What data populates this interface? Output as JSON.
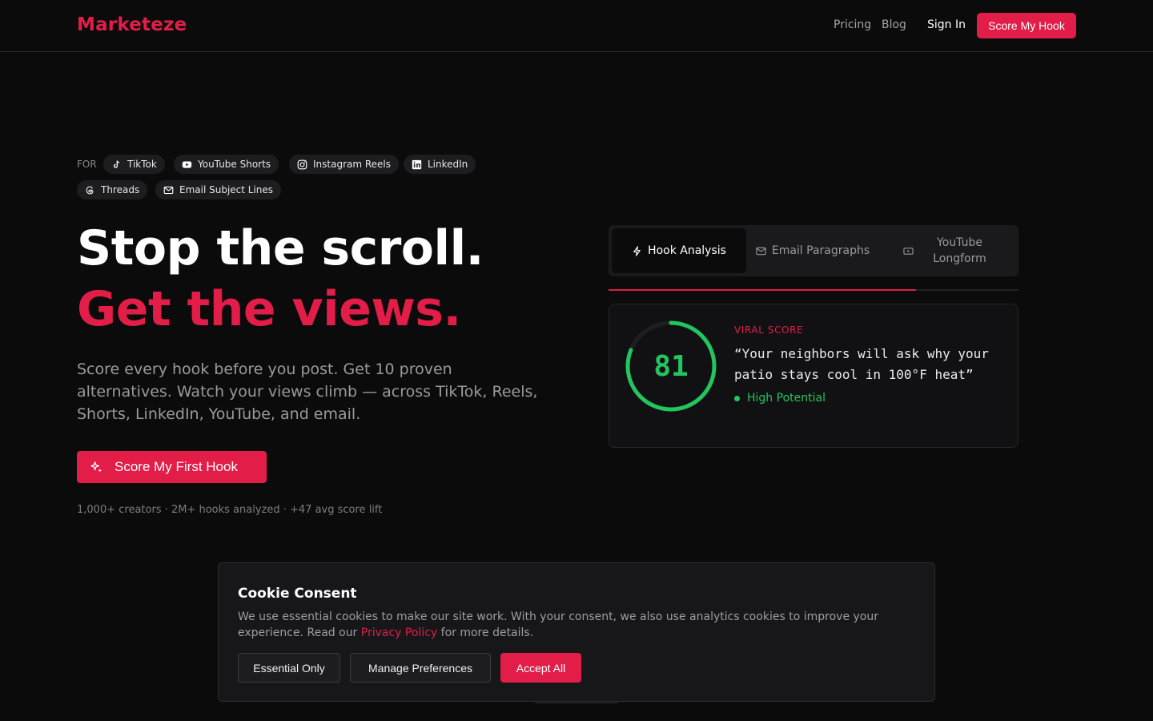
{
  "header": {
    "logo": "Marketeze",
    "nav": [
      "Pricing",
      "Blog"
    ],
    "sign_in": "Sign In",
    "cta": "Score My Hook"
  },
  "platforms": {
    "label": "FOR",
    "items": [
      {
        "label": "TikTok",
        "icon": "tiktok-icon"
      },
      {
        "label": "YouTube Shorts",
        "icon": "youtube-icon"
      },
      {
        "label": "Instagram Reels",
        "icon": "instagram-icon"
      },
      {
        "label": "LinkedIn",
        "icon": "linkedin-icon"
      },
      {
        "label": "Threads",
        "icon": "threads-icon"
      },
      {
        "label": "Email Subject Lines",
        "icon": "mail-icon"
      }
    ]
  },
  "hero": {
    "title_main": "Stop the scroll.",
    "title_accent": "Get the views.",
    "subtitle": "Score every hook before you post. Get 10 proven alternatives. Watch your views climb — across TikTok, Reels, Shorts, LinkedIn, YouTube, and email.",
    "cta": "Score My First Hook",
    "stats": "1,000+ creators · 2M+ hooks analyzed · +47 avg score lift"
  },
  "demo": {
    "tabs": [
      {
        "label": "Hook Analysis",
        "icon": "bolt-icon",
        "active": true
      },
      {
        "label": "Email Paragraphs",
        "icon": "mail-icon",
        "active": false
      },
      {
        "label": "YouTube Longform",
        "icon": "video-icon",
        "active": false
      }
    ],
    "carousel_progress": 0.75,
    "score_card": {
      "score": "81",
      "score_value": 81,
      "label": "VIRAL SCORE",
      "quote": "“Your neighbors will ask why your patio stays cool in 100°F heat”",
      "status": "High Potential"
    }
  },
  "cookie": {
    "title": "Cookie Consent",
    "text_before": "We use essential cookies to make our site work. With your consent, we also use analytics cookies to improve your experience. Read our ",
    "link": "Privacy Policy",
    "text_after": " for more details.",
    "buttons": {
      "essential": "Essential Only",
      "manage": "Manage Preferences",
      "accept": "Accept All"
    }
  },
  "colors": {
    "background": "#0b0b0c",
    "accent": "#e11d48",
    "success": "#22c55e",
    "muted": "#9a9a9a"
  }
}
